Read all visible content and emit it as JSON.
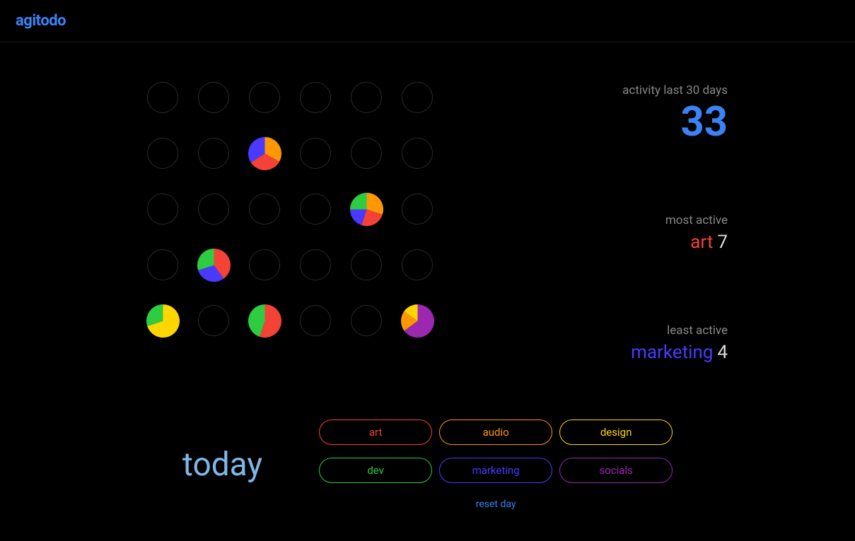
{
  "app": {
    "name": "agitodo"
  },
  "colors": {
    "art": "#f44336",
    "audio": "#ff9800",
    "design": "#ffd600",
    "dev": "#2ecc40",
    "marketing": "#4a3aff",
    "socials": "#9c27b0",
    "accent": "#3b82f6"
  },
  "grid": {
    "rows": 5,
    "cols": 6,
    "days": [
      [
        null,
        null,
        null,
        null,
        null,
        null
      ],
      [
        null,
        null,
        [
          [
            "audio",
            0.33
          ],
          [
            "art",
            0.33
          ],
          [
            "marketing",
            0.34
          ]
        ],
        null,
        null,
        null
      ],
      [
        null,
        null,
        null,
        null,
        [
          [
            "audio",
            0.3
          ],
          [
            "art",
            0.25
          ],
          [
            "marketing",
            0.2
          ],
          [
            "dev",
            0.25
          ]
        ],
        null
      ],
      [
        null,
        [
          [
            "art",
            0.4
          ],
          [
            "marketing",
            0.3
          ],
          [
            "dev",
            0.3
          ]
        ],
        null,
        null,
        null,
        null
      ],
      [
        [
          [
            "design",
            0.7
          ],
          [
            "dev",
            0.3
          ]
        ],
        null,
        [
          [
            "art",
            0.55
          ],
          [
            "dev",
            0.45
          ]
        ],
        null,
        null,
        [
          [
            "socials",
            0.65
          ],
          [
            "audio",
            0.2
          ],
          [
            "design",
            0.15
          ]
        ]
      ]
    ]
  },
  "stats": {
    "activity_label": "activity last 30 days",
    "activity_value": "33",
    "most_label": "most active",
    "most_cat": "art",
    "most_val": "7",
    "least_label": "least active",
    "least_cat": "marketing",
    "least_val": "4"
  },
  "today": {
    "label": "today",
    "reset": "reset day",
    "categories": [
      {
        "key": "art",
        "label": "art"
      },
      {
        "key": "audio",
        "label": "audio"
      },
      {
        "key": "design",
        "label": "design"
      },
      {
        "key": "dev",
        "label": "dev"
      },
      {
        "key": "marketing",
        "label": "marketing"
      },
      {
        "key": "socials",
        "label": "socials"
      }
    ]
  }
}
